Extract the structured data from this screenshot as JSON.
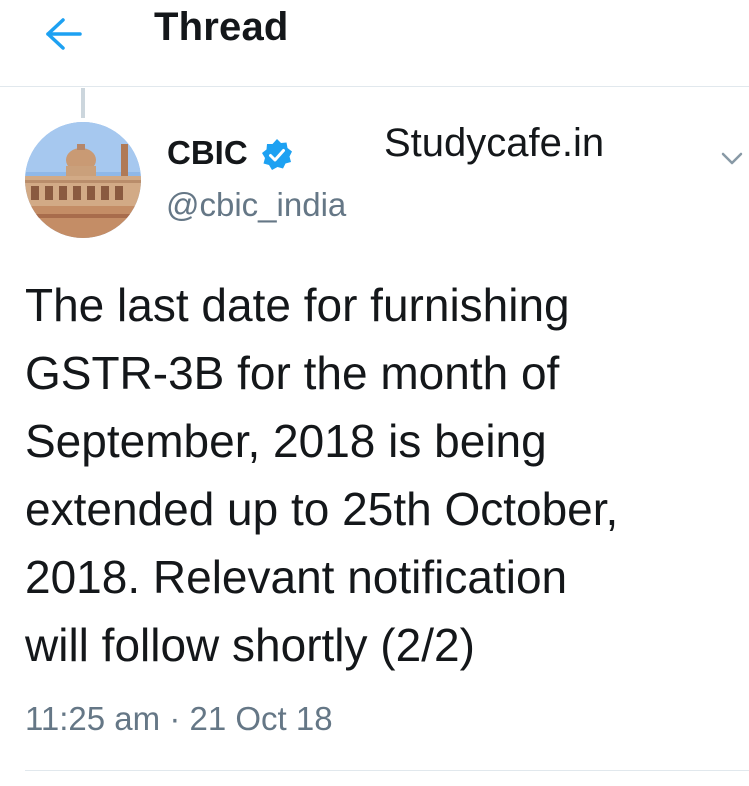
{
  "header": {
    "back_icon": "arrow-left-icon",
    "title": "Thread"
  },
  "tweet": {
    "author": {
      "name": "CBIC",
      "handle": "@cbic_india",
      "verified": true,
      "verified_icon": "verified-badge-icon"
    },
    "watermark": "Studycafe.in",
    "caret_icon": "chevron-down-icon",
    "text": "The last date for furnishing\nGSTR-3B for the month of\nSeptember, 2018 is being\nextended up to 25th October,\n2018. Relevant notification\nwill follow shortly (2/2)",
    "time": "11:25 am",
    "date": "21 Oct 18"
  },
  "colors": {
    "accent": "#1da1f2",
    "text_primary": "#14171a",
    "text_secondary": "#657786",
    "divider": "#e1e8ed"
  }
}
